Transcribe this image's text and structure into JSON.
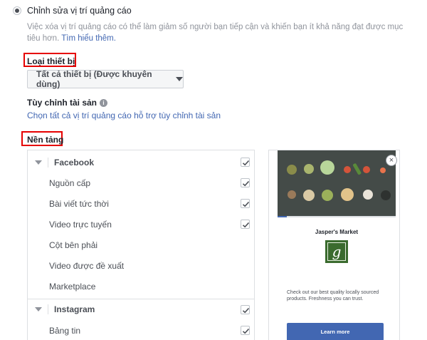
{
  "placement": {
    "radio_label": "Chỉnh sửa vị trí quảng cáo",
    "description": "Việc xóa vị trí quảng cáo có thể làm giảm số người bạn tiếp cận và khiến bạn ít khả năng đạt được mục tiêu hơn.",
    "learn_more_link": "Tìm hiểu thêm."
  },
  "device": {
    "label": "Loại thiết bị",
    "selected": "Tất cả thiết bị (Được khuyên dùng)"
  },
  "asset": {
    "label": "Tùy chỉnh tài sản",
    "info_icon": "i",
    "link": "Chọn tất cả vị trí quảng cáo hỗ trợ tùy chỉnh tài sản"
  },
  "platforms": {
    "label": "Nền tảng",
    "groups": [
      {
        "name": "Facebook",
        "checked": true,
        "items": [
          {
            "label": "Nguồn cấp",
            "checked": true
          },
          {
            "label": "Bài viết tức thời",
            "checked": true
          },
          {
            "label": "Video trực tuyến",
            "checked": true
          },
          {
            "label": "Cột bên phải",
            "checked": false
          },
          {
            "label": "Video được đề xuất",
            "checked": false
          },
          {
            "label": "Marketplace",
            "checked": false
          }
        ]
      },
      {
        "name": "Instagram",
        "checked": true,
        "items": [
          {
            "label": "Bảng tin",
            "checked": true
          }
        ]
      }
    ]
  },
  "preview": {
    "close_icon": "×",
    "progress": 0.08,
    "store_name": "Jasper's Market",
    "logo_letter": "g",
    "ad_text": "Check out our best quality locally sourced products. Freshness you can trust.",
    "cta": "Learn more"
  },
  "colors": {
    "link": "#4267b2",
    "highlight": "#e60000",
    "logo_bg": "#3a6b2e"
  }
}
